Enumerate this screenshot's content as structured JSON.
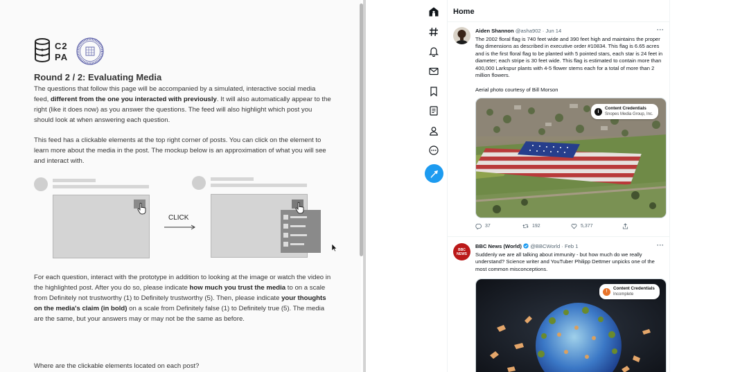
{
  "survey": {
    "logo_text_line1": "C2",
    "logo_text_line2": "PA",
    "title": "Round 2 / 2: Evaluating Media",
    "p1": {
      "a": "The questions that follow this page will be accompanied by a simulated, interactive social media feed, ",
      "b": "different from the one you interacted with previously",
      "c": ". It will also automatically appear to the right (like it does now) as you answer the questions. The feed will also highlight which post you should look at when answering each question."
    },
    "p2": "This feed has a clickable elements at the top right corner of posts. You can click on the element to learn more about the media in the post. The mockup below is an approximation of what you will see and interact with.",
    "click_label": "CLICK",
    "p3": {
      "a": "For each question, interact with the prototype in addition to looking at the image or watch the video in the highlighted post. After you do so, please indicate ",
      "b": "how much you trust the media",
      "c": " to on a scale from Definitely not trustworthy (1) to Definitely trustworthy (5). Then, please indicate ",
      "d": "your thoughts on the media's claim (in bold)",
      "e": " on a scale from Definitely false (1) to Definitely true (5). The media are the same, but your answers may or may not be the same as before."
    },
    "p4": "Where are the clickable elements located on each post?"
  },
  "feed": {
    "home_title": "Home",
    "nav_icons": [
      "home-icon",
      "explore-hashtag-icon",
      "notifications-bell-icon",
      "messages-envelope-icon",
      "bookmarks-icon",
      "lists-icon",
      "profile-icon",
      "more-icon"
    ],
    "posts": [
      {
        "name": "Aiden Shannon",
        "handle": "@asha902",
        "sep": "·",
        "date": "Jun 14",
        "more": "···",
        "text": "The 2002 floral flag is 740 feet wide and 390 feet high and maintains the proper flag dimensions as described in executive order #10834. This flag is 6.65 acres and is the first floral flag to be planted with 5 pointed stars, each star is 24 feet in diameter; each stripe is 30 feet wide. This flag is estimated to contain more than 400,000 Larkspur plants with 4-5 flower stems each for a total of more than 2 million flowers.",
        "credit": "Aerial photo courtesy of Bill Morson",
        "cc_title": "Content Credentials",
        "cc_sub": "Snopes Media Group, Inc.",
        "replies": "37",
        "reposts": "192",
        "likes": "5,377"
      },
      {
        "name": "BBC News (World)",
        "handle": "@BBCWorld",
        "sep": "·",
        "date": "Feb 1",
        "more": "···",
        "text": "Suddenly we are all talking about immunity - but how much do we really understand? Science writer and YouTuber Philipp Dettmer unpicks one of the most common misconceptions.",
        "avatar_text": "BBC NEWS",
        "cc_title": "Content Credentials",
        "cc_sub": "Incomplete"
      }
    ]
  },
  "colors": {
    "accent": "#1d9bf0",
    "bbc_red": "#bb1919",
    "verified": "#1d9bf0",
    "cc_incomplete": "#e8742a"
  }
}
